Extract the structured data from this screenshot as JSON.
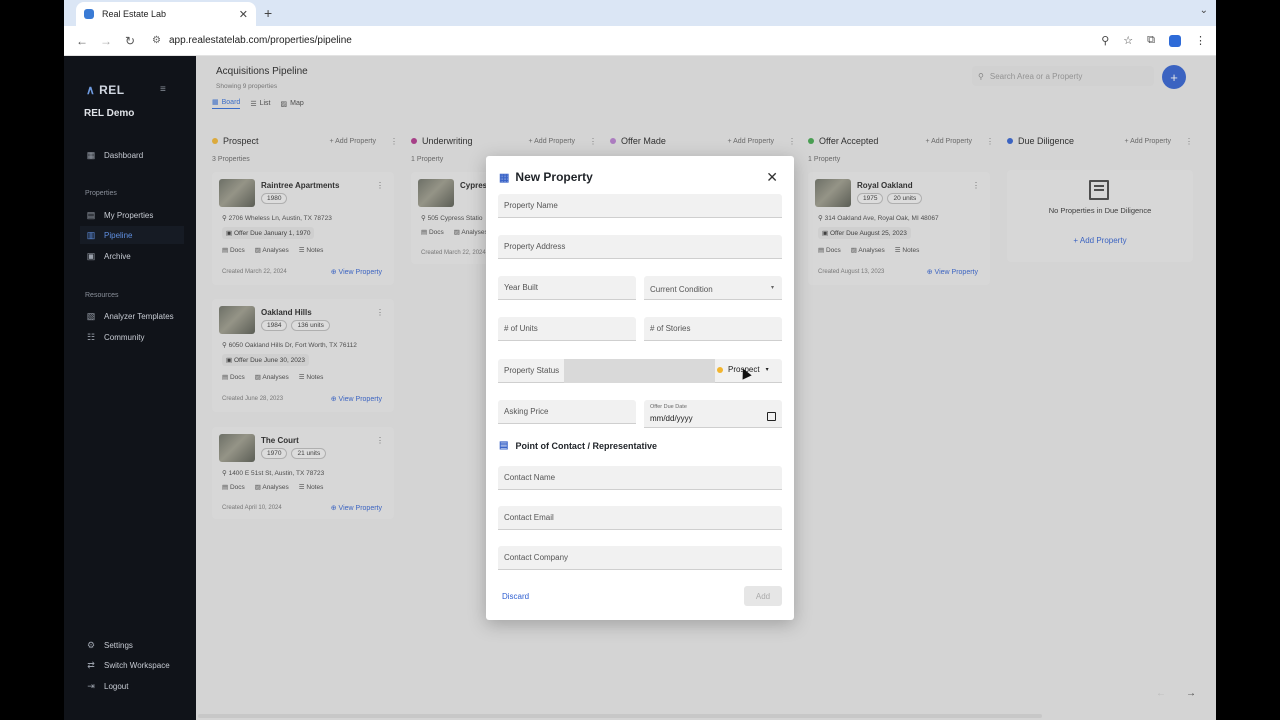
{
  "browser": {
    "tab_title": "Real Estate Lab",
    "tab_close": "✕",
    "new_tab": "+",
    "url": "app.realestatelab.com/properties/pipeline"
  },
  "sidebar": {
    "logo": "REL",
    "workspace": "REL Demo",
    "dashboard": "Dashboard",
    "properties_section": "Properties",
    "my_properties": "My Properties",
    "pipeline": "Pipeline",
    "archive": "Archive",
    "resources_section": "Resources",
    "analyzer_templates": "Analyzer Templates",
    "community": "Community",
    "settings": "Settings",
    "switch_workspace": "Switch Workspace",
    "logout": "Logout"
  },
  "header": {
    "title": "Acquisitions Pipeline",
    "subtitle": "Showing 9 properties",
    "view_board": "Board",
    "view_list": "List",
    "view_map": "Map",
    "search_placeholder": "Search Area or a Property",
    "fab": "+"
  },
  "columns": [
    {
      "name": "Prospect",
      "color": "#f2b52f",
      "add": "+ Add Property",
      "count": "3 Properties"
    },
    {
      "name": "Underwriting",
      "color": "#b0338a",
      "add": "+ Add Property",
      "count": "1 Property"
    },
    {
      "name": "Offer Made",
      "color": "#b77dd0",
      "add": "+ Add Property",
      "count": ""
    },
    {
      "name": "Offer Accepted",
      "color": "#3fa64a",
      "add": "+ Add Property",
      "count": "1 Property"
    },
    {
      "name": "Due Diligence",
      "color": "#2e5fd1",
      "add": "+ Add Property",
      "count": ""
    }
  ],
  "cards": {
    "raintree": {
      "title": "Raintree Apartments",
      "year": "1980",
      "addr": "2706 Wheless Ln, Austin, TX 78723",
      "offer": "Offer Due January 1, 1970",
      "created": "Created March 22, 2024"
    },
    "oakland": {
      "title": "Oakland Hills",
      "year": "1984",
      "units": "136 units",
      "addr": "6050 Oakland Hills Dr, Fort Worth, TX 76112",
      "offer": "Offer Due June 30, 2023",
      "created": "Created June 28, 2023"
    },
    "court": {
      "title": "The Court",
      "year": "1970",
      "units": "21 units",
      "addr": "1400 E 51st St, Austin, TX 78723",
      "created": "Created April 10, 2024"
    },
    "cypress": {
      "title": "Cypress",
      "addr": "505 Cypress Statio",
      "created": "Created March 22, 2024"
    },
    "royal": {
      "title": "Royal Oakland",
      "year": "1975",
      "units": "20 units",
      "addr": "314 Oakland Ave, Royal Oak, MI 48067",
      "offer": "Offer Due August 25, 2023",
      "created": "Created August 13, 2023"
    },
    "docs": "Docs",
    "analyses": "Analyses",
    "notes": "Notes",
    "view_property": "View Property"
  },
  "empty_dd": {
    "text": "No Properties in Due Diligence",
    "add": "+ Add Property"
  },
  "modal": {
    "title": "New Property",
    "close": "✕",
    "property_name": "Property Name",
    "property_address": "Property Address",
    "year_built": "Year Built",
    "current_condition": "Current Condition",
    "units": "# of Units",
    "stories": "# of Stories",
    "property_status": "Property Status",
    "status_value": "Prospect",
    "asking_price": "Asking Price",
    "offer_due_label": "Offer Due Date",
    "offer_due_value": "mm/dd/yyyy",
    "contact_section": "Point of Contact / Representative",
    "contact_name": "Contact Name",
    "contact_email": "Contact Email",
    "contact_company": "Contact Company",
    "discard": "Discard",
    "add": "Add"
  }
}
